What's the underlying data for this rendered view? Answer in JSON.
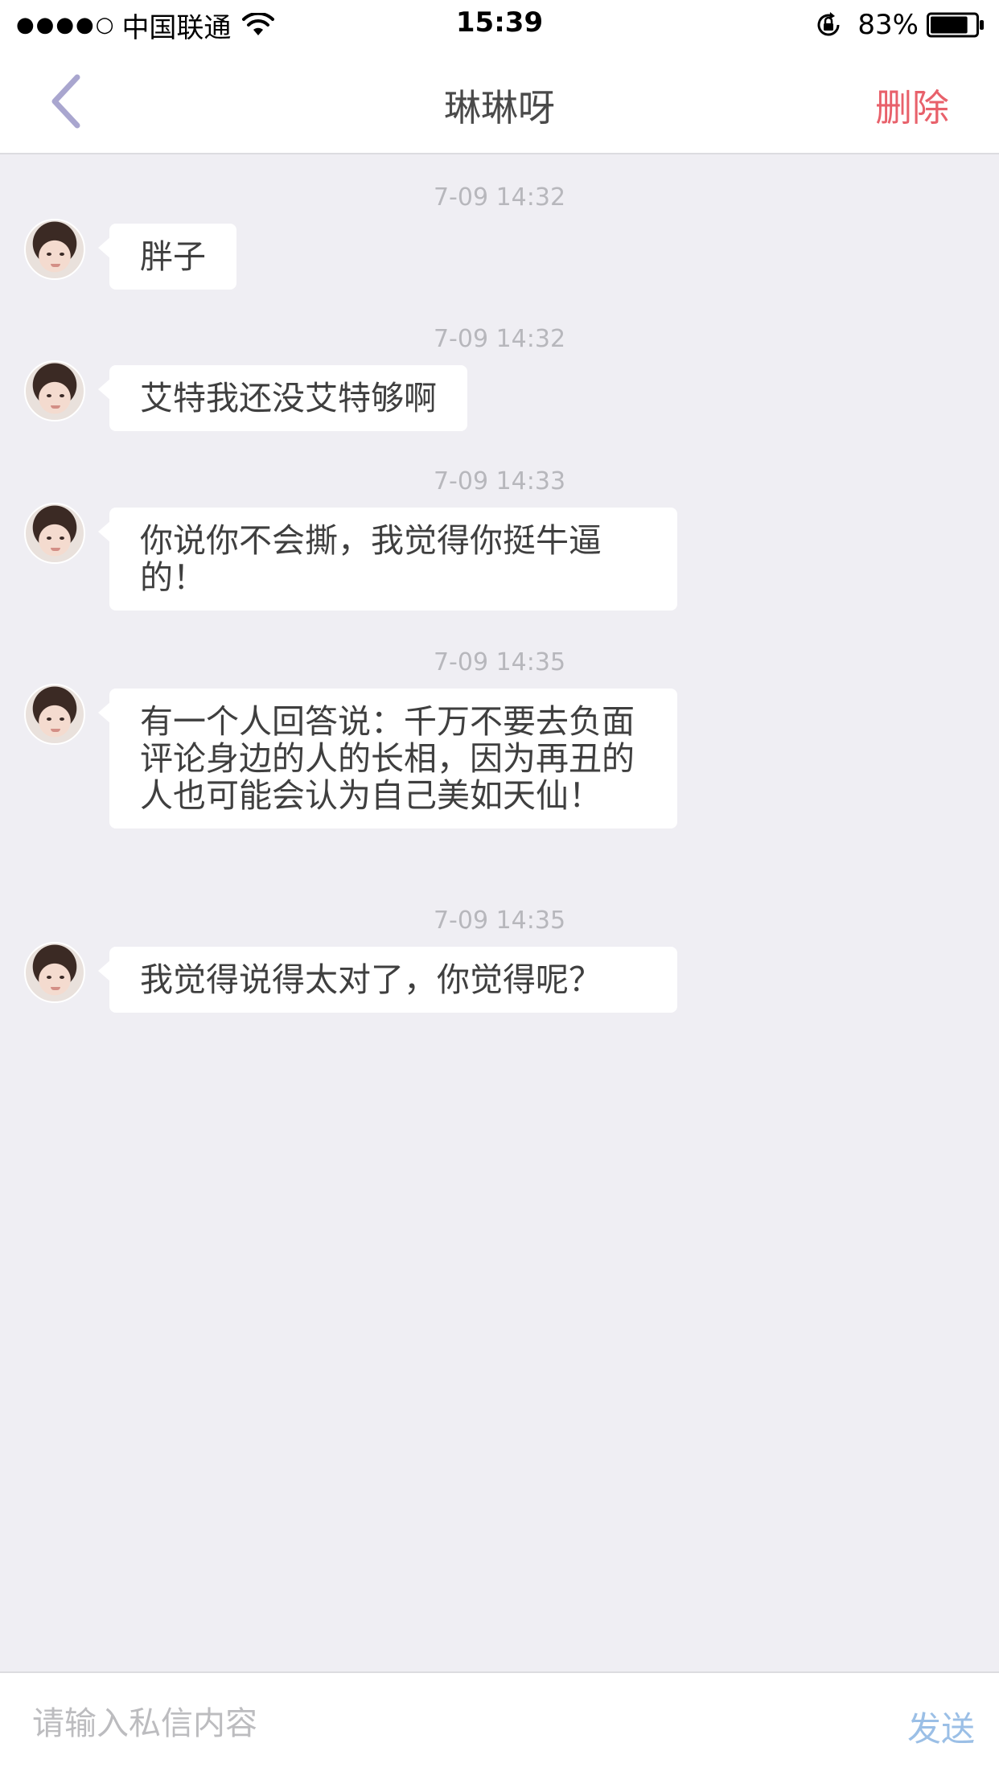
{
  "status_bar": {
    "signal": "●●●●○",
    "carrier": "中国联通",
    "time": "15:39",
    "battery_percent": "83%",
    "battery_level": 0.83,
    "icons": [
      "wifi-icon",
      "rotation-lock-icon",
      "battery-icon"
    ]
  },
  "nav": {
    "back_icon": "chevron-left-icon",
    "title": "琳琳呀",
    "delete_label": "删除"
  },
  "messages": [
    {
      "time": "7-09 14:32",
      "text": "胖子"
    },
    {
      "time": "7-09 14:32",
      "text": "艾特我还没艾特够啊"
    },
    {
      "time": "7-09 14:33",
      "text": "你说你不会撕，我觉得你挺牛逼的！"
    },
    {
      "time": "7-09 14:35",
      "text": "有一个人回答说：千万不要去负面评论身边的人的长相，因为再丑的人也可能会认为自己美如天仙！"
    },
    {
      "time": "7-09 14:35",
      "text": "我觉得说得太对了，你觉得呢？"
    }
  ],
  "input": {
    "placeholder": "请输入私信内容",
    "value": "",
    "send_label": "发送"
  },
  "colors": {
    "background": "#efeef3",
    "delete": "#e8616b",
    "send": "#9bbfe6",
    "back_chevron": "#a9a6cf"
  }
}
